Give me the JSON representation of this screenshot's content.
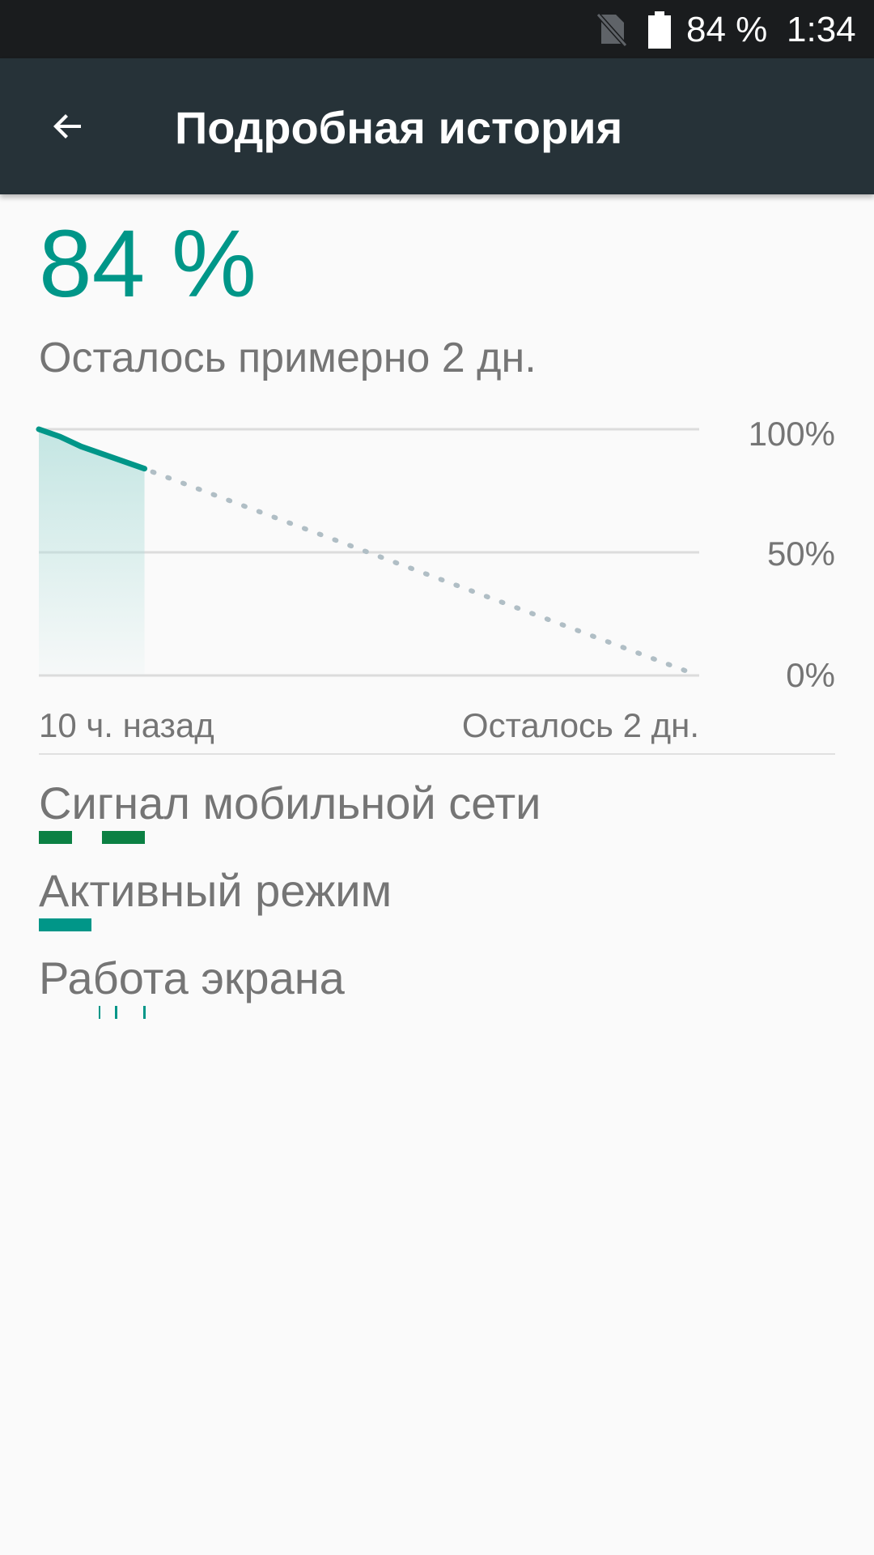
{
  "status_bar": {
    "battery_percent": "84 %",
    "time": "1:34",
    "icons": [
      "no-sim-icon",
      "battery-icon"
    ]
  },
  "app_bar": {
    "back_icon": "arrow-back-icon",
    "title": "Подробная история"
  },
  "summary": {
    "battery_level": "84 %",
    "estimate": "Осталось примерно 2 дн."
  },
  "chart_data": {
    "type": "line",
    "y_ticks": [
      "100%",
      "50%",
      "0%"
    ],
    "x_labels": [
      "10 ч. назад",
      "Осталось 2 дн."
    ],
    "ylim": [
      0,
      100
    ],
    "series": [
      {
        "values": [
          100,
          97,
          93,
          90,
          87,
          84
        ]
      }
    ],
    "projection": [
      84,
      0
    ],
    "colors": {
      "line": "#009688",
      "fill": "#b2dfdb",
      "projection": "#b0bec5",
      "grid": "#dcdcdc"
    }
  },
  "legend": [
    {
      "label": "Сигнал мобильной сети",
      "color": "#0b8043",
      "segments": [
        [
          0.0,
          0.05
        ],
        [
          0.095,
          0.16
        ]
      ]
    },
    {
      "label": "Активный режим",
      "color": "#009688",
      "segments": [
        [
          0.0,
          0.08
        ]
      ]
    },
    {
      "label": "Работа экрана",
      "color": "#009688",
      "segments": [
        [
          0.09,
          0.093
        ],
        [
          0.115,
          0.118
        ],
        [
          0.158,
          0.161
        ]
      ]
    }
  ]
}
